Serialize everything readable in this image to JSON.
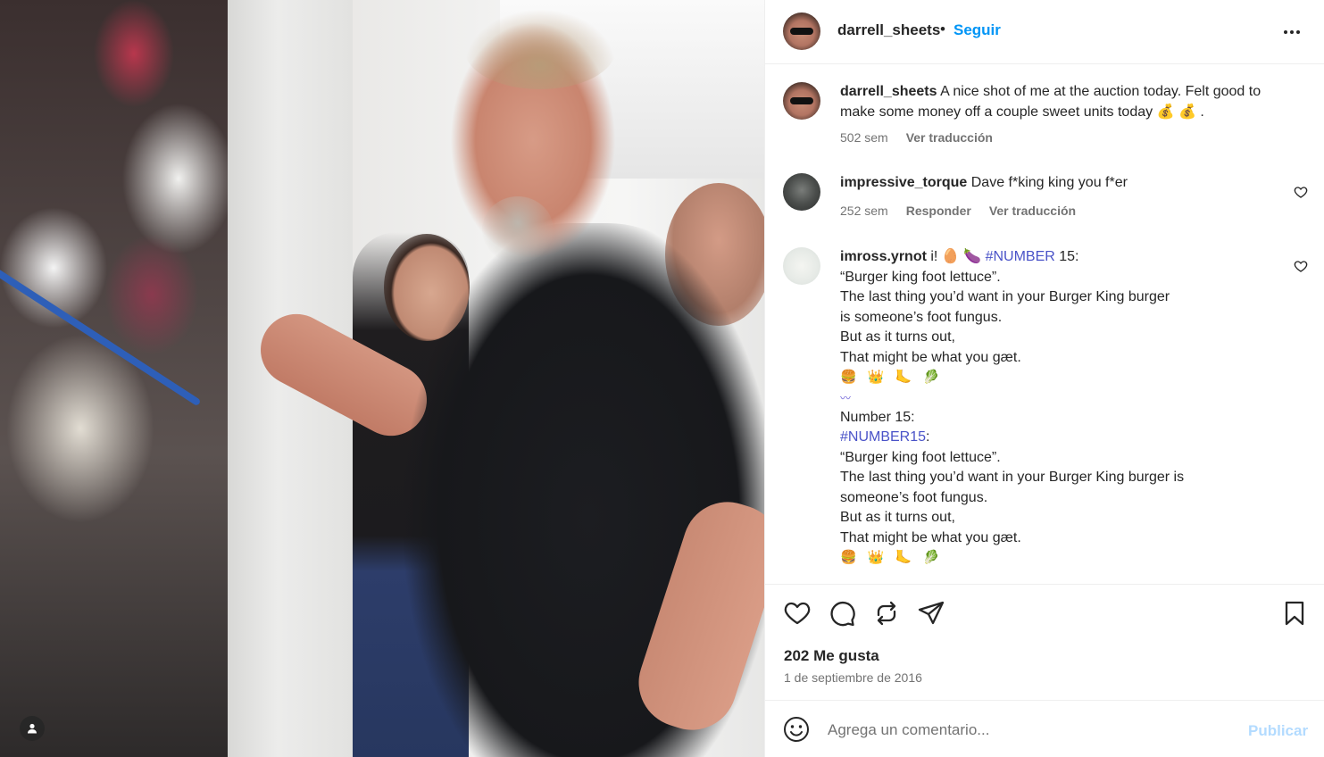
{
  "post": {
    "author": "darrell_sheets",
    "follow_label": "Seguir",
    "separator": "•",
    "more_icon": "more-horizontal-icon"
  },
  "caption": {
    "user": "darrell_sheets",
    "text": "A nice shot of me at the auction today. Felt good to make some money off a couple sweet units today",
    "emojis": "💰 💰 .",
    "time": "502 sem",
    "translate": "Ver traducción"
  },
  "comments": [
    {
      "user": "impressive_torque",
      "text": "Dave f*king king you f*er",
      "time": "252 sem",
      "reply": "Responder",
      "translate": "Ver traducción"
    },
    {
      "user": "imross.yrnot",
      "intro": "i! 🥚 🍆",
      "hashtag1": "#NUMBER",
      "after_hashtag1": " 15:",
      "lines_a": [
        "“Burger king foot lettuce”.",
        "The last thing you’d want in your Burger King burger",
        "is someone’s foot fungus.",
        "But as it turns out,",
        "That might be what you gæt."
      ],
      "emoji_row_a": "🍔 👑 🦶 🥬",
      "wave": "〰",
      "number_line": "Number 15:",
      "hashtag2": "#NUMBER15",
      "after_hashtag2": ":",
      "lines_b": [
        "“Burger king foot lettuce”.",
        "The last thing you’d want in your Burger King burger is",
        "someone’s foot fungus.",
        "But as it turns out,",
        "That might be what you gæt."
      ],
      "emoji_row_b": "🍔 👑 🦶 🥬"
    }
  ],
  "actions": {
    "likes": "202 Me gusta",
    "date": "1 de septiembre de 2016"
  },
  "composer": {
    "placeholder": "Agrega un comentario...",
    "publish": "Publicar"
  },
  "colors": {
    "accent": "#0095f6",
    "publish_disabled": "#b3dbff",
    "muted": "#737373",
    "hashtag": "#4a53c8"
  }
}
